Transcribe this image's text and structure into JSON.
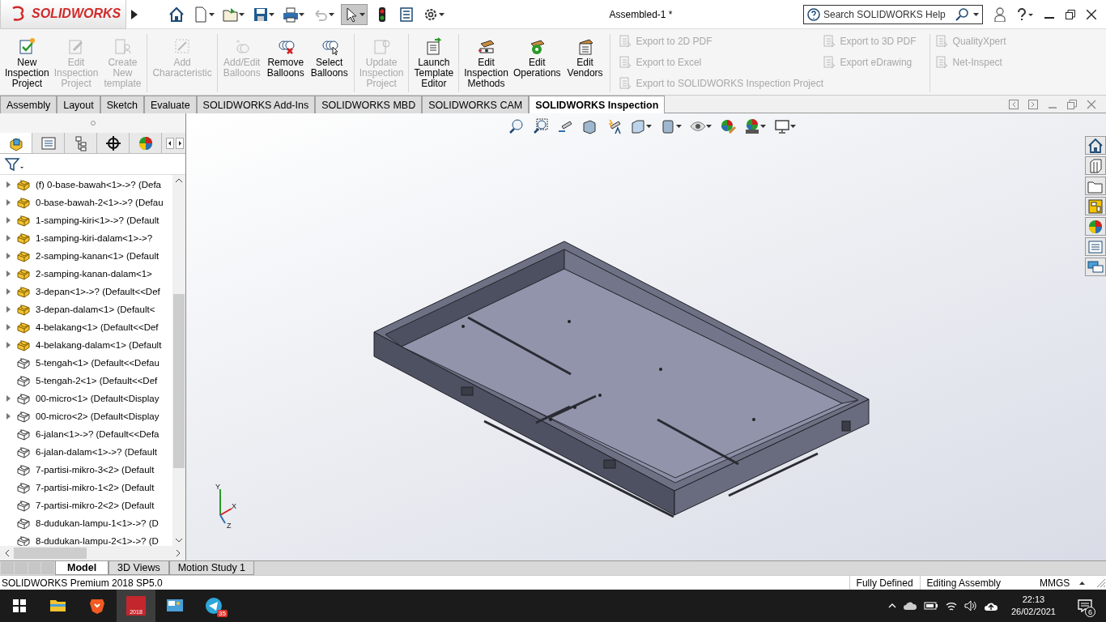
{
  "app": {
    "logo": "SOLIDWORKS"
  },
  "window": {
    "title": "Assembled-1 *"
  },
  "help_search": {
    "placeholder": "Search SOLIDWORKS Help"
  },
  "ribbon": {
    "groups": [
      [
        {
          "label": "New\nInspection\nProject",
          "disabled": false
        },
        {
          "label": "Edit\nInspection\nProject",
          "disabled": true
        },
        {
          "label": "Create\nNew\ntemplate",
          "disabled": true
        }
      ],
      [
        {
          "label": "Add\nCharacteristic",
          "disabled": true
        }
      ],
      [
        {
          "label": "Add/Edit\nBalloons",
          "disabled": true
        },
        {
          "label": "Remove\nBalloons",
          "disabled": false
        },
        {
          "label": "Select\nBalloons",
          "disabled": false
        }
      ],
      [
        {
          "label": "Update\nInspection\nProject",
          "disabled": true
        }
      ],
      [
        {
          "label": "Launch\nTemplate\nEditor",
          "disabled": false
        }
      ],
      [
        {
          "label": "Edit\nInspection\nMethods",
          "disabled": false
        },
        {
          "label": "Edit\nOperations",
          "disabled": false
        },
        {
          "label": "Edit\nVendors",
          "disabled": false
        }
      ]
    ],
    "export_rows": [
      [
        {
          "label": "Export to 2D PDF",
          "disabled": true
        },
        {
          "label": "Export to 3D PDF",
          "disabled": true
        }
      ],
      [
        {
          "label": "Export to Excel",
          "disabled": true
        },
        {
          "label": "Export eDrawing",
          "disabled": true
        }
      ],
      [
        {
          "label": "Export to SOLIDWORKS Inspection Project",
          "disabled": true
        }
      ]
    ],
    "links": [
      {
        "label": "QualityXpert",
        "disabled": true
      },
      {
        "label": "Net-Inspect",
        "disabled": true
      }
    ]
  },
  "tabs": [
    {
      "label": "Assembly",
      "selected": false
    },
    {
      "label": "Layout",
      "selected": false
    },
    {
      "label": "Sketch",
      "selected": false
    },
    {
      "label": "Evaluate",
      "selected": false
    },
    {
      "label": "SOLIDWORKS Add-Ins",
      "selected": false
    },
    {
      "label": "SOLIDWORKS MBD",
      "selected": false
    },
    {
      "label": "SOLIDWORKS CAM",
      "selected": false
    },
    {
      "label": "SOLIDWORKS Inspection",
      "selected": true
    }
  ],
  "tree": {
    "items": [
      {
        "label": "(f) 0-base-bawah<1>->? (Defa",
        "kind": "assembly",
        "expandable": true
      },
      {
        "label": "0-base-bawah-2<1>->? (Defau",
        "kind": "assembly",
        "expandable": true
      },
      {
        "label": "1-samping-kiri<1>->? (Default",
        "kind": "assembly",
        "expandable": true
      },
      {
        "label": "1-samping-kiri-dalam<1>->?",
        "kind": "assembly",
        "expandable": true
      },
      {
        "label": "2-samping-kanan<1> (Default",
        "kind": "assembly",
        "expandable": true
      },
      {
        "label": "2-samping-kanan-dalam<1>",
        "kind": "assembly",
        "expandable": true
      },
      {
        "label": "3-depan<1>->? (Default<<Def",
        "kind": "assembly",
        "expandable": true
      },
      {
        "label": "3-depan-dalam<1> (Default<",
        "kind": "assembly",
        "expandable": true
      },
      {
        "label": "4-belakang<1> (Default<<Def",
        "kind": "assembly",
        "expandable": true
      },
      {
        "label": "4-belakang-dalam<1> (Default",
        "kind": "assembly",
        "expandable": true
      },
      {
        "label": "5-tengah<1> (Default<<Defau",
        "kind": "part",
        "expandable": false
      },
      {
        "label": "5-tengah-2<1> (Default<<Def",
        "kind": "part",
        "expandable": false
      },
      {
        "label": "00-micro<1> (Default<Display",
        "kind": "part",
        "expandable": true
      },
      {
        "label": "00-micro<2> (Default<Display",
        "kind": "part",
        "expandable": true
      },
      {
        "label": "6-jalan<1>->? (Default<<Defa",
        "kind": "part",
        "expandable": false
      },
      {
        "label": "6-jalan-dalam<1>->? (Default",
        "kind": "part",
        "expandable": false
      },
      {
        "label": "7-partisi-mikro-3<2> (Default",
        "kind": "part",
        "expandable": false
      },
      {
        "label": "7-partisi-mikro-1<2> (Default",
        "kind": "part",
        "expandable": false
      },
      {
        "label": "7-partisi-mikro-2<2> (Default",
        "kind": "part",
        "expandable": false
      },
      {
        "label": "8-dudukan-lampu-1<1>->? (D",
        "kind": "part",
        "expandable": false
      },
      {
        "label": "8-dudukan-lampu-2<1>->? (D",
        "kind": "part",
        "expandable": false
      }
    ]
  },
  "triad": [
    "Y",
    "X",
    "Z"
  ],
  "bottom_tabs": [
    {
      "label": "Model",
      "selected": true
    },
    {
      "label": "3D Views",
      "selected": false
    },
    {
      "label": "Motion Study 1",
      "selected": false
    }
  ],
  "status_bar": {
    "product": "SOLIDWORKS Premium 2018 SP5.0",
    "state": "Fully Defined",
    "mode": "Editing Assembly",
    "units": "MMGS"
  },
  "taskbar": {
    "apps": [
      {
        "kind": "explorer",
        "active": false
      },
      {
        "kind": "brave",
        "active": false
      },
      {
        "kind": "solidworks",
        "active": true,
        "caption": "2018"
      },
      {
        "kind": "control",
        "active": false
      },
      {
        "kind": "telegram",
        "active": false,
        "badge": "35"
      }
    ],
    "time": "22:13",
    "date": "26/02/2021",
    "notifications": "6"
  }
}
